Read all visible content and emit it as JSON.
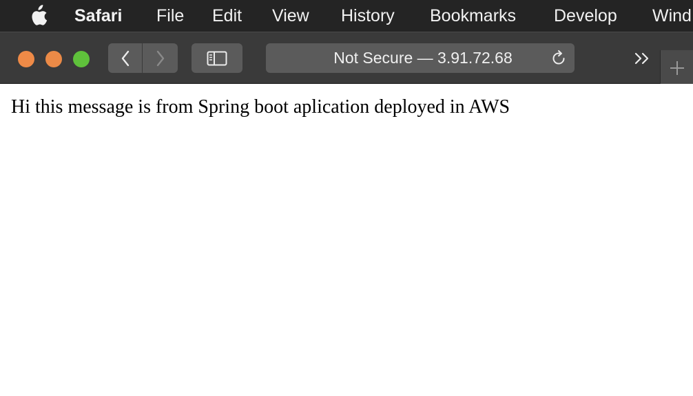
{
  "menubar": {
    "apple_icon": "apple-logo-icon",
    "app_name": "Safari",
    "items": [
      "File",
      "Edit",
      "View",
      "History",
      "Bookmarks",
      "Develop",
      "Wind"
    ]
  },
  "toolbar": {
    "address": "Not Secure — 3.91.72.68",
    "icons": {
      "back": "chevron-left-icon",
      "forward": "chevron-right-icon",
      "sidebar": "sidebar-icon",
      "reload": "reload-icon",
      "overflow": "double-chevron-right-icon",
      "new_tab": "plus-icon"
    },
    "traffic_colors": {
      "close": "#ee8a47",
      "minimize": "#eb8a47",
      "zoom": "#5fc13b"
    }
  },
  "page": {
    "message": "Hi this message is from Spring boot aplication deployed in AWS"
  }
}
